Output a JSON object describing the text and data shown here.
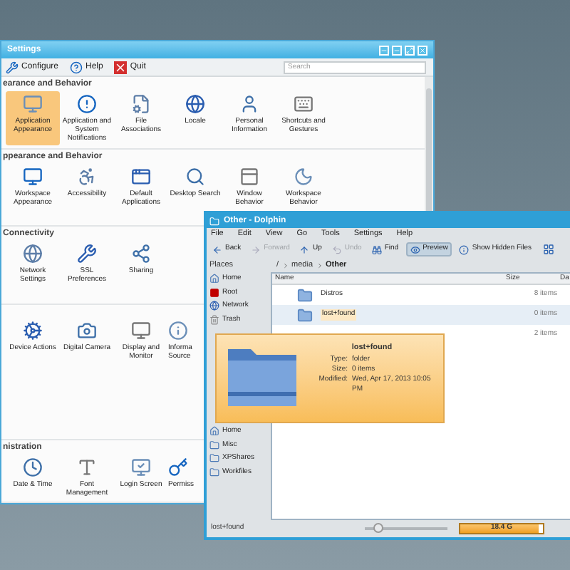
{
  "settings": {
    "title": "Settings",
    "toolbar": [
      {
        "label": "Configure"
      },
      {
        "label": "Help"
      },
      {
        "label": "Quit"
      }
    ],
    "search": {
      "placeholder": "Search"
    },
    "sections": [
      {
        "heading": "earance and Behavior",
        "items": [
          {
            "label": "Application Appearance",
            "selected": true
          },
          {
            "label": "Application and System Notifications",
            "selected": false
          },
          {
            "label": "File Associations",
            "selected": false
          },
          {
            "label": "Locale",
            "selected": false
          },
          {
            "label": "Personal Information",
            "selected": false
          },
          {
            "label": "Shortcuts and Gestures",
            "selected": false
          }
        ]
      },
      {
        "heading": "ppearance and Behavior",
        "items": [
          {
            "label": "Workspace Appearance",
            "selected": false
          },
          {
            "label": "Accessibility",
            "selected": false
          },
          {
            "label": "Default Applications",
            "selected": false
          },
          {
            "label": "Desktop Search",
            "selected": false
          },
          {
            "label": "Window Behavior",
            "selected": false
          },
          {
            "label": "Workspace Behavior",
            "selected": false
          }
        ]
      },
      {
        "heading": "Connectivity",
        "items": [
          {
            "label": "Network Settings",
            "selected": false
          },
          {
            "label": "SSL Preferences",
            "selected": false
          },
          {
            "label": "Sharing",
            "selected": false
          }
        ]
      },
      {
        "items": [
          {
            "label": "Device Actions",
            "selected": false
          },
          {
            "label": "Digital Camera",
            "selected": false
          },
          {
            "label": "Display and Monitor",
            "selected": false
          },
          {
            "label": "Informa Source",
            "selected": false,
            "kind": "partial"
          }
        ]
      },
      {
        "heading": "nistration",
        "items": [
          {
            "label": "Date & Time",
            "selected": false
          },
          {
            "label": "Font Management",
            "selected": false
          },
          {
            "label": "Login Screen",
            "selected": false
          },
          {
            "label": "Permiss",
            "selected": false,
            "kind": "partial"
          }
        ]
      }
    ]
  },
  "dolphin": {
    "title": "Other - Dolphin",
    "menu": [
      "File",
      "Edit",
      "View",
      "Go",
      "Tools",
      "Settings",
      "Help"
    ],
    "toolbar": [
      {
        "label": "Back",
        "selected": false,
        "disabled": false
      },
      {
        "label": "Forward",
        "selected": false,
        "disabled": true
      },
      {
        "label": "Up",
        "selected": false,
        "disabled": false
      },
      {
        "label": "Undo",
        "selected": false,
        "disabled": true
      },
      {
        "label": "Find",
        "selected": false,
        "disabled": false
      },
      {
        "label": "Preview",
        "selected": true,
        "disabled": false
      },
      {
        "label": "Show Hidden Files",
        "selected": false,
        "disabled": false
      }
    ],
    "places": {
      "title": "Places",
      "items": [
        "Home",
        "Root",
        "Network",
        "Trash",
        "Home",
        "Misc",
        "XPShares",
        "Workfiles"
      ]
    },
    "breadcrumb": [
      "/",
      "media",
      "Other"
    ],
    "columns": [
      "Name",
      "Size",
      "Da"
    ],
    "rows": [
      {
        "name": "Distros",
        "size": "8 items",
        "selected": false
      },
      {
        "name": "lost+found",
        "size": "0 items",
        "selected": true
      },
      {
        "size": "2 items",
        "selected": false
      }
    ],
    "tooltip": {
      "title": "lost+found",
      "fields": [
        {
          "label": "Type:",
          "value": "folder"
        },
        {
          "label": "Size:",
          "value": "0 items"
        },
        {
          "label": "Modified:",
          "value": "Wed, Apr 17, 2013 10:05 PM"
        }
      ]
    },
    "status": {
      "text": "lost+found",
      "zoom": {
        "level": 0.15
      },
      "free": {
        "label": "18.4 G",
        "level": 0.95
      }
    }
  }
}
